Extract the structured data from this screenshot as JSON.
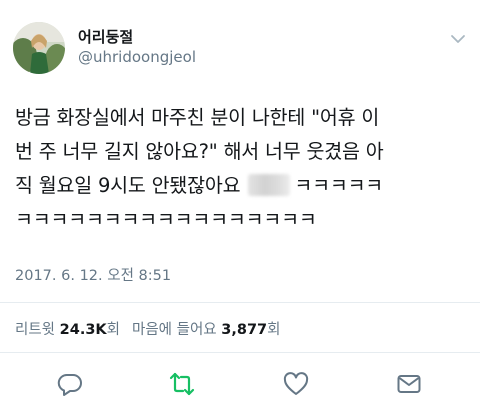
{
  "author": {
    "display_name": "어리둥절",
    "handle": "@uhridoongjeol"
  },
  "tweet": {
    "line1": "방금 화장실에서 마주친 분이 나한테 \"어휴 이",
    "line2": "번 주 너무 길지 않아요?\" 해서 너무 웃겼음 아",
    "line3_before": "직 월요일 9시도 안됐잖아요",
    "line3_after": "ㅋㅋㅋㅋㅋ",
    "line4": "ㅋㅋㅋㅋㅋㅋㅋㅋㅋㅋㅋㅋㅋㅋㅋㅋㅋ"
  },
  "timestamp": "2017. 6. 12. 오전 8:51",
  "stats": {
    "retweets_label": "리트윗",
    "retweets_count": "24.3K",
    "retweets_unit": "회",
    "likes_label": "마음에 들어요",
    "likes_count": "3,877",
    "likes_unit": "회"
  },
  "colors": {
    "text": "#14171a",
    "secondary": "#657786",
    "retweet_accent": "#17bf63",
    "icon": "#657786",
    "divider": "#e6ecf0"
  },
  "icons": {
    "reply": "reply-icon",
    "retweet": "retweet-icon",
    "like": "heart-icon",
    "dm": "envelope-icon",
    "menu": "chevron-down-icon"
  }
}
